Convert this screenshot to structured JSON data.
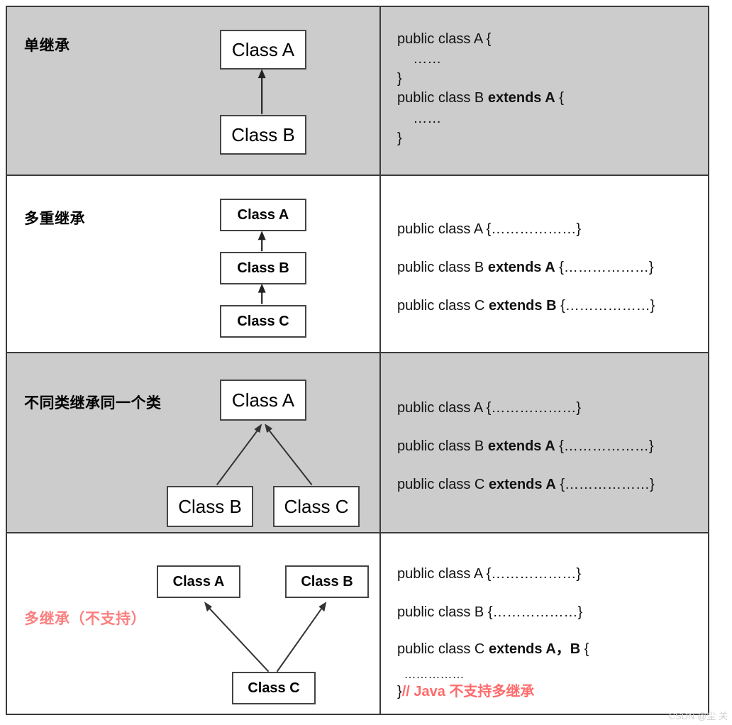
{
  "diagram": {
    "title_implicit": "Java 继承类型对照表",
    "watermark": "CSDN @尘 关",
    "accent_red": "#fa8080",
    "shade_gray": "#cccccc",
    "border_color": "#3a3a3a"
  },
  "rows": [
    {
      "label": "单继承",
      "label_red": false,
      "shaded": true,
      "boxes": [
        {
          "text": "Class A",
          "bold": false
        },
        {
          "text": "Class B",
          "bold": false
        }
      ],
      "code_lines": [
        {
          "plain": "public class A {",
          "bold": "",
          "tail": ""
        },
        {
          "plain": "    ……",
          "bold": "",
          "tail": ""
        },
        {
          "plain": "}",
          "bold": "",
          "tail": ""
        },
        {
          "plain": "public class B ",
          "bold": "extends A",
          "tail": " {"
        },
        {
          "plain": "    ……",
          "bold": "",
          "tail": ""
        },
        {
          "plain": "}",
          "bold": "",
          "tail": ""
        }
      ]
    },
    {
      "label": "多重继承",
      "label_red": false,
      "shaded": false,
      "boxes": [
        {
          "text": "Class A",
          "bold": true
        },
        {
          "text": "Class B",
          "bold": true
        },
        {
          "text": "Class C",
          "bold": true
        }
      ],
      "code_lines": [
        {
          "plain": "public class A {",
          "bold": "",
          "tail": "………………}"
        },
        {
          "plain": "public class B ",
          "bold": "extends A",
          "tail": " {………………}"
        },
        {
          "plain": "public class C ",
          "bold": "extends B",
          "tail": " {………………}"
        }
      ]
    },
    {
      "label": "不同类继承同一个类",
      "label_red": false,
      "shaded": true,
      "boxes": [
        {
          "text": "Class A",
          "bold": false
        },
        {
          "text": "Class B",
          "bold": false
        },
        {
          "text": "Class C",
          "bold": false
        }
      ],
      "code_lines": [
        {
          "plain": "public class A {",
          "bold": "",
          "tail": "………………}"
        },
        {
          "plain": "public class B ",
          "bold": "extends A",
          "tail": " {………………}"
        },
        {
          "plain": "public class C ",
          "bold": "extends A",
          "tail": " {………………}"
        }
      ]
    },
    {
      "label": "多继承（不支持）",
      "label_red": true,
      "shaded": false,
      "boxes": [
        {
          "text": "Class A",
          "bold": true
        },
        {
          "text": "Class B",
          "bold": true
        },
        {
          "text": "Class C",
          "bold": true
        }
      ],
      "code_lines": [
        {
          "plain": "public class A {",
          "bold": "",
          "tail": "………………}"
        },
        {
          "plain": "public class B {",
          "bold": "",
          "tail": "………………}"
        },
        {
          "plain": "public class C ",
          "bold": "extends A，B",
          "tail": " {"
        },
        {
          "plain": "  ……………",
          "bold": "",
          "tail": ""
        },
        {
          "plain": "}",
          "bold": "",
          "tail": "",
          "red_suffix": "// Java 不支持多继承"
        }
      ]
    }
  ]
}
